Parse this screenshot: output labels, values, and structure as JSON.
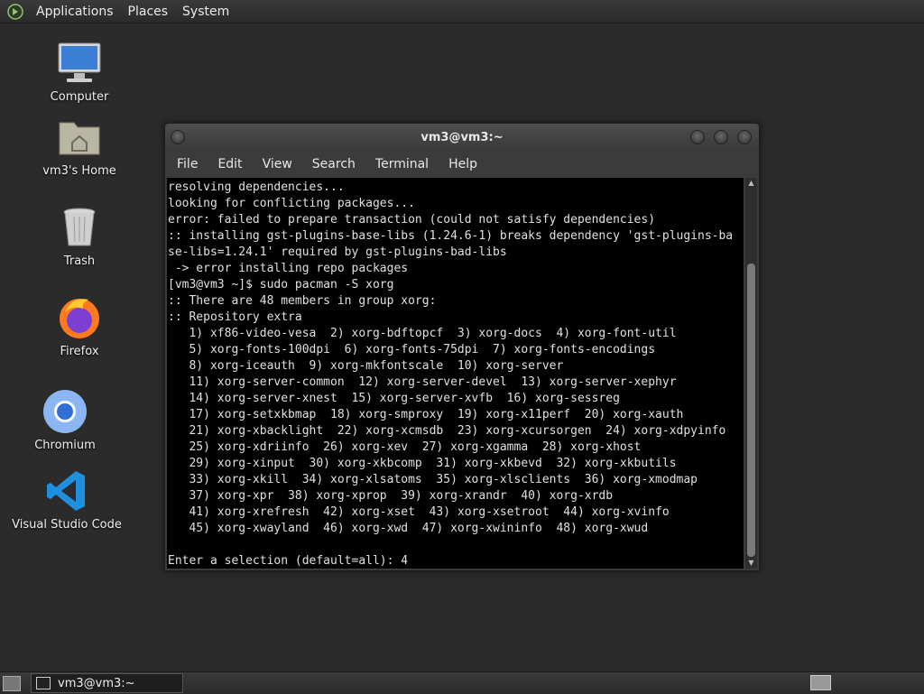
{
  "top_panel": {
    "menus": [
      "Applications",
      "Places",
      "System"
    ]
  },
  "desktop_icons": [
    {
      "label": "Computer",
      "icon": "computer-icon"
    },
    {
      "label": "vm3's Home",
      "icon": "home-folder-icon"
    },
    {
      "label": "Trash",
      "icon": "trash-icon"
    },
    {
      "label": "Firefox",
      "icon": "firefox-icon"
    },
    {
      "label": "Chromium",
      "icon": "chromium-icon"
    },
    {
      "label": "Visual Studio Code",
      "icon": "vscode-icon"
    }
  ],
  "terminal": {
    "title": "vm3@vm3:~",
    "menu": [
      "File",
      "Edit",
      "View",
      "Search",
      "Terminal",
      "Help"
    ],
    "lines": [
      "resolving dependencies...",
      "looking for conflicting packages...",
      "error: failed to prepare transaction (could not satisfy dependencies)",
      ":: installing gst-plugins-base-libs (1.24.6-1) breaks dependency 'gst-plugins-ba",
      "se-libs=1.24.1' required by gst-plugins-bad-libs",
      " -> error installing repo packages",
      "[vm3@vm3 ~]$ sudo pacman -S xorg",
      ":: There are 48 members in group xorg:",
      ":: Repository extra",
      "   1) xf86-video-vesa  2) xorg-bdftopcf  3) xorg-docs  4) xorg-font-util",
      "   5) xorg-fonts-100dpi  6) xorg-fonts-75dpi  7) xorg-fonts-encodings",
      "   8) xorg-iceauth  9) xorg-mkfontscale  10) xorg-server",
      "   11) xorg-server-common  12) xorg-server-devel  13) xorg-server-xephyr",
      "   14) xorg-server-xnest  15) xorg-server-xvfb  16) xorg-sessreg",
      "   17) xorg-setxkbmap  18) xorg-smproxy  19) xorg-x11perf  20) xorg-xauth",
      "   21) xorg-xbacklight  22) xorg-xcmsdb  23) xorg-xcursorgen  24) xorg-xdpyinfo",
      "   25) xorg-xdriinfo  26) xorg-xev  27) xorg-xgamma  28) xorg-xhost",
      "   29) xorg-xinput  30) xorg-xkbcomp  31) xorg-xkbevd  32) xorg-xkbutils",
      "   33) xorg-xkill  34) xorg-xlsatoms  35) xorg-xlsclients  36) xorg-xmodmap",
      "   37) xorg-xpr  38) xorg-xprop  39) xorg-xrandr  40) xorg-xrdb",
      "   41) xorg-xrefresh  42) xorg-xset  43) xorg-xsetroot  44) xorg-xvinfo",
      "   45) xorg-xwayland  46) xorg-xwd  47) xorg-xwininfo  48) xorg-xwud",
      "",
      "Enter a selection (default=all): 4"
    ]
  },
  "bottom_panel": {
    "task_label": "vm3@vm3:~"
  }
}
